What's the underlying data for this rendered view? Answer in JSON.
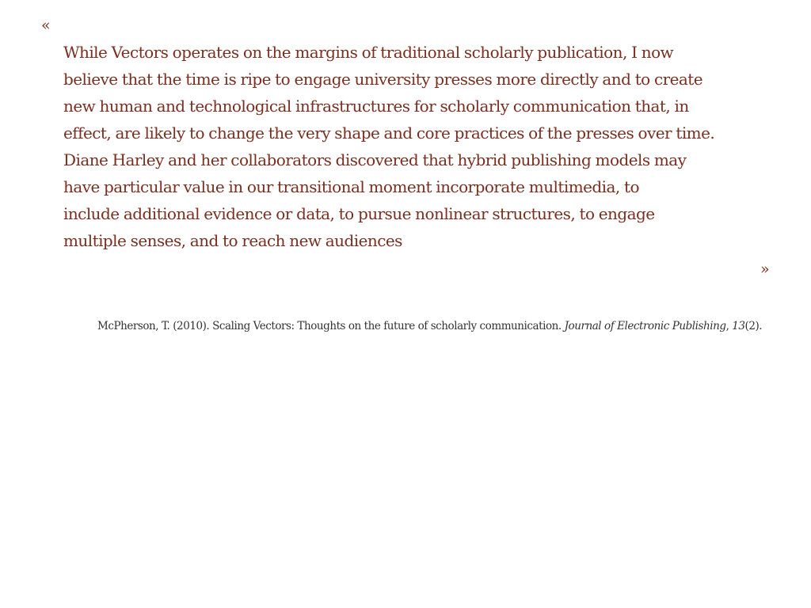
{
  "quote": {
    "open_mark": "«",
    "close_mark": "»",
    "lines": [
      "While Vectors operates on the margins of traditional scholarly publication, I now",
      "believe that the time is ripe to engage university presses more directly and to create",
      "new human and technological infrastructures for scholarly communication that, in",
      "effect, are likely to change the very shape and core practices of the presses over time.",
      "Diane Harley and her collaborators discovered that hybrid publishing models may",
      "have particular value in our transitional moment incorporate multimedia, to",
      "include additional evidence or data, to pursue nonlinear structures, to engage",
      "multiple senses, and to reach new audiences"
    ]
  },
  "citation": {
    "authors_year_title": "McPherson, T. (2010). Scaling Vectors: Thoughts on the future of scholarly communication. ",
    "journal": "Journal of Electronic Publishing",
    "separator": ", ",
    "volume": "13",
    "issue": "(2)."
  },
  "colors": {
    "quote_text": "#7a2e1f",
    "citation_text": "#333333",
    "background": "#ffffff"
  }
}
